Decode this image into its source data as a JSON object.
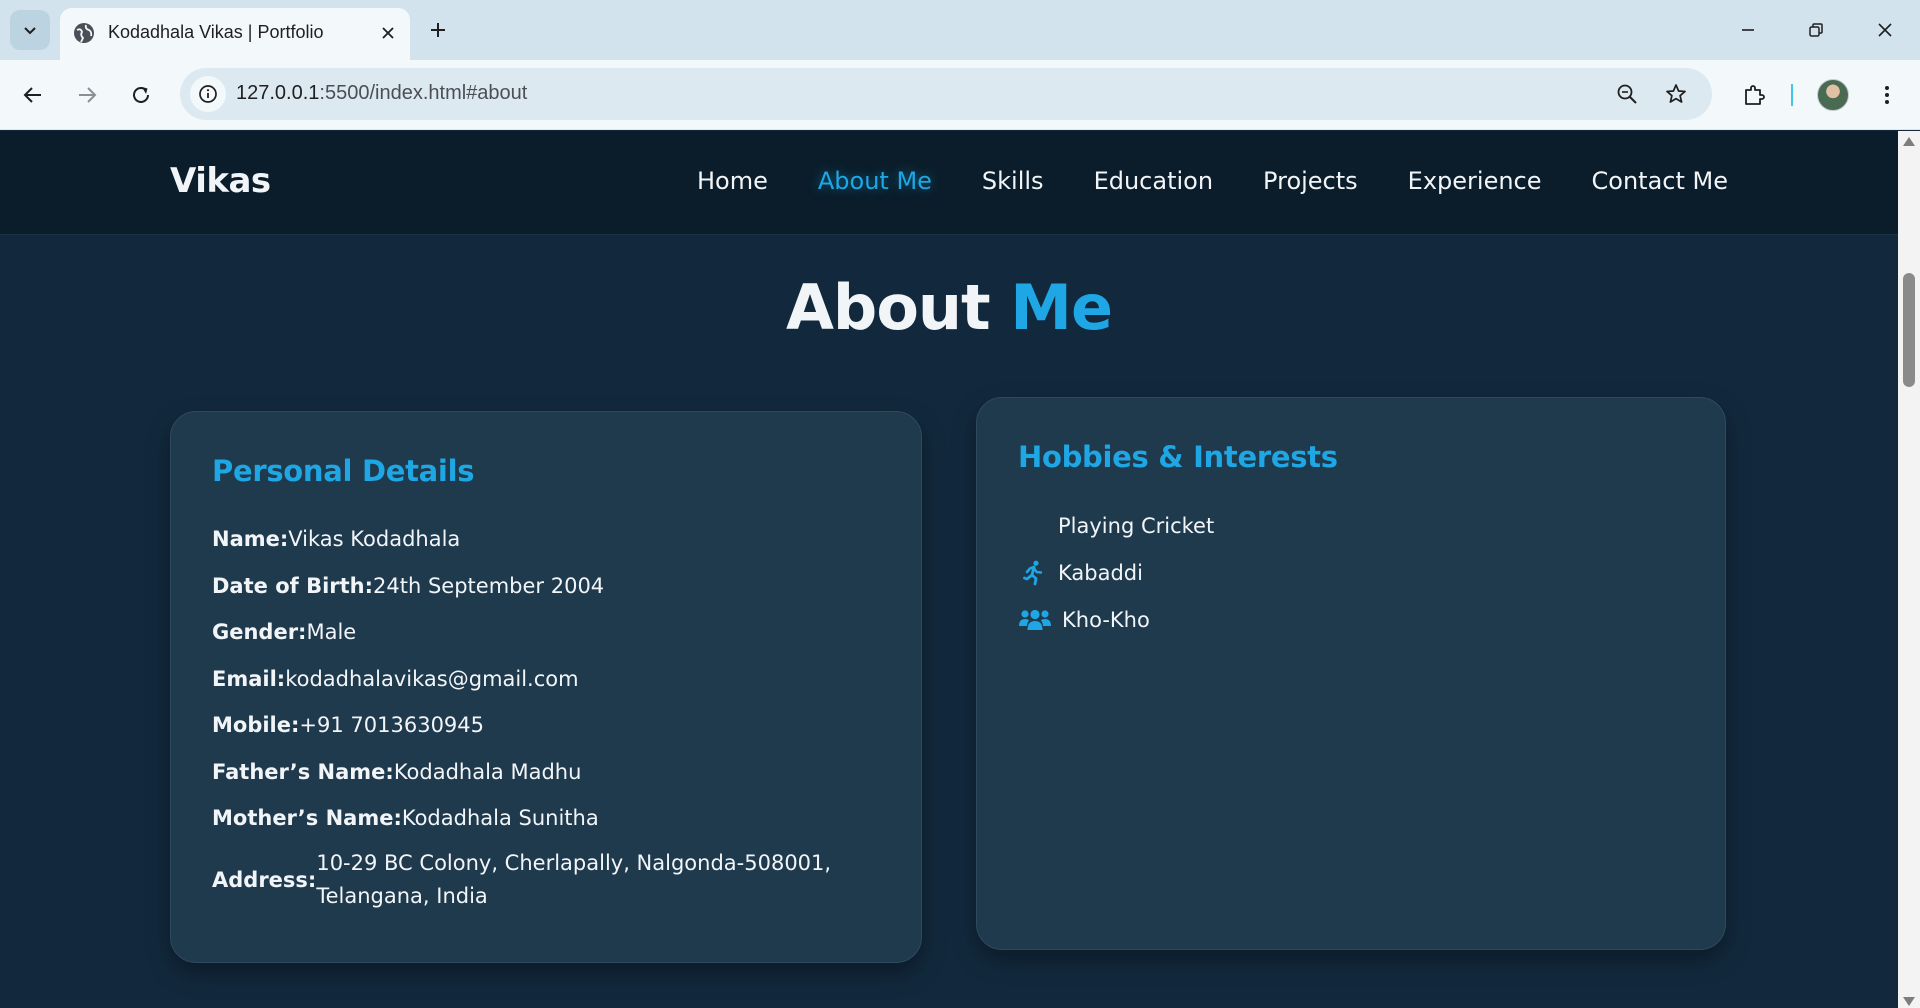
{
  "browser": {
    "tab_title": "Kodadhala Vikas | Portfolio",
    "url_host": "127.0.0.1",
    "url_rest": ":5500/index.html#about"
  },
  "site": {
    "logo": "Vikas",
    "nav": [
      {
        "label": "Home",
        "active": false
      },
      {
        "label": "About Me",
        "active": true
      },
      {
        "label": "Skills",
        "active": false
      },
      {
        "label": "Education",
        "active": false
      },
      {
        "label": "Projects",
        "active": false
      },
      {
        "label": "Experience",
        "active": false
      },
      {
        "label": "Contact Me",
        "active": false
      }
    ]
  },
  "about": {
    "title_main": "About",
    "title_accent": "Me",
    "personal": {
      "heading": "Personal Details",
      "details": [
        {
          "key": "Name:",
          "value": "Vikas Kodadhala"
        },
        {
          "key": "Date of Birth:",
          "value": "24th September 2004"
        },
        {
          "key": "Gender:",
          "value": "Male"
        },
        {
          "key": "Email:",
          "value": "kodadhalavikas@gmail.com"
        },
        {
          "key": "Mobile:",
          "value": "+91 7013630945"
        },
        {
          "key": "Father’s Name:",
          "value": "Kodadhala Madhu"
        },
        {
          "key": "Mother’s Name:",
          "value": "Kodadhala Sunitha"
        },
        {
          "key": "Address:",
          "value": "10-29 BC Colony, Cherlapally, Nalgonda-508001, Telangana, India"
        }
      ]
    },
    "hobbies": {
      "heading": "Hobbies & Interests",
      "items": [
        {
          "label": "Playing Cricket",
          "icon": "none"
        },
        {
          "label": "Kabaddi",
          "icon": "running-person-icon"
        },
        {
          "label": "Kho-Kho",
          "icon": "users-group-icon"
        }
      ]
    }
  },
  "colors": {
    "accent": "#1ea7e4",
    "page_bg": "#12293d",
    "header_bg": "#0b1d2a",
    "card_bg": "#1f394d"
  }
}
